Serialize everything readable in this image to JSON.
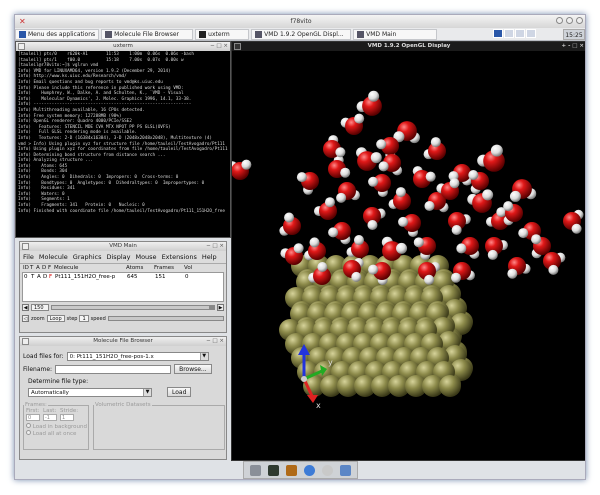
{
  "system": {
    "title": "f78vito",
    "clock": "15:25",
    "taskbar": [
      {
        "label": "Menu des applications",
        "icon": "app-menu-icon"
      },
      {
        "label": "Molecule File Browser",
        "icon": "window-icon"
      },
      {
        "label": "uxterm",
        "icon": "terminal-icon"
      },
      {
        "label": "VMD 1.9.2 OpenGL Displ...",
        "icon": "window-icon"
      },
      {
        "label": "VMD Main",
        "icon": "window-icon"
      }
    ]
  },
  "xterm": {
    "title": "uxterm",
    "lines": [
      "[tauleil] pts/0    r620k-A1       11:53    1:00m  0.06s  0.06s -bash",
      "[tauleil] pts/1    f00.0          15:18    7.00s  0.07s  0.00s w",
      "[tauleil@r78vito:~]$ vglrun vmd",
      "Info) VMD for LINUXAMD64, version 1.9.2 (December 29, 2014)",
      "Info) http://www.ks.uiuc.edu/Research/vmd/",
      "Info) Email questions and bug reports to vmd@ks.uiuc.edu",
      "Info) Please include this reference in published work using VMD:",
      "Info)    Humphrey, W., Dalke, A. and Schulten, K., `VMD - Visual",
      "Info)    Molecular Dynamics', J. Molec. Graphics 1996, 14.1, 33-38.",
      "Info) -------------------------------------------------------------",
      "Info) Multithreading available, 16 CPUs detected.",
      "Info) Free system memory: 127288MB (98%)",
      "Info) OpenGL renderer: Quadro 4000/PCIe/SSE2",
      "Info)   Features: STENCIL MDE CVA MTX NPOT PP PS GLSL(OVFS)",
      "Info)   Full GLSL rendering mode is available.",
      "Info)   Textures: 2-D (16384x16384), 3-D (2048x2048x2048), Multitexture (4)",
      "vmd > Info) Using plugin xyz for structure file /home/tauleil/TestAvogadro/Pt111",
      "Info) Using plugin xyz for coordinates from file /home/tauleil/TestAvogadro/Pt111",
      "Info) Determining bond structure from distance search ...",
      "Info) Analyzing structure ...",
      "Info)    Atoms: 645",
      "Info)    Bonds: 304",
      "Info)    Angles: 0  Dihedrals: 0  Impropers: 0  Cross-terms: 0",
      "Info)    Bondtypes: 0  Angletypes: 0  Dihedraltypes: 0  Impropertypes: 0",
      "Info)    Residues: 341",
      "Info)    Waters: 0",
      "Info)    Segments: 1",
      "Info)    Fragments: 341   Protein: 0   Nucleic: 0",
      "Info) Finished with coordinate file /home/tauleil/TestAvogadro/Pt111_151H2O_free"
    ]
  },
  "display": {
    "title": "VMD 1.9.2 OpenGL Display",
    "controls": "+ - □ ×",
    "axes": {
      "x": "x",
      "y": "y"
    }
  },
  "vmd_main": {
    "title": "VMD Main",
    "menu": [
      "File",
      "Molecule",
      "Graphics",
      "Display",
      "Mouse",
      "Extensions",
      "Help"
    ],
    "headers": {
      "id": "ID",
      "t": "T",
      "a": "A",
      "d": "D",
      "f": "F",
      "name": "Molecule",
      "atoms": "Atoms",
      "frames": "Frames",
      "vol": "Vol"
    },
    "row": {
      "id": "0",
      "t": "T",
      "a": "A",
      "d": "D",
      "f": "F",
      "name": "Pt111_151H2O_free-p",
      "atoms": "645",
      "frames": "151",
      "vol": "0"
    },
    "anim": {
      "frame": "150",
      "zoom": "zoom",
      "loop": "Loop",
      "step_label": "step",
      "step": "1",
      "speed": "speed"
    }
  },
  "file_browser": {
    "title": "Molecule File Browser",
    "load_for_label": "Load files for:",
    "load_for_value": "0: Pt111_151H2O_free-pos-1.x",
    "filename_label": "Filename:",
    "filename_value": "",
    "browse": "Browse...",
    "type_label": "Determine file type:",
    "type_value": "Automatically",
    "load": "Load",
    "frames_legend": "Frames:",
    "first": "First:",
    "last": "Last:",
    "stride": "Stride:",
    "first_v": "0",
    "last_v": "-1",
    "stride_v": "1",
    "bg": "Load in background",
    "all": "Load all at once",
    "vol_legend": "Volumetric Datasets"
  },
  "colors": {
    "oxygen": "#d41616",
    "hydrogen": "#ffffff",
    "platinum": "#8c8a4a",
    "accent": "#2a57a8"
  }
}
